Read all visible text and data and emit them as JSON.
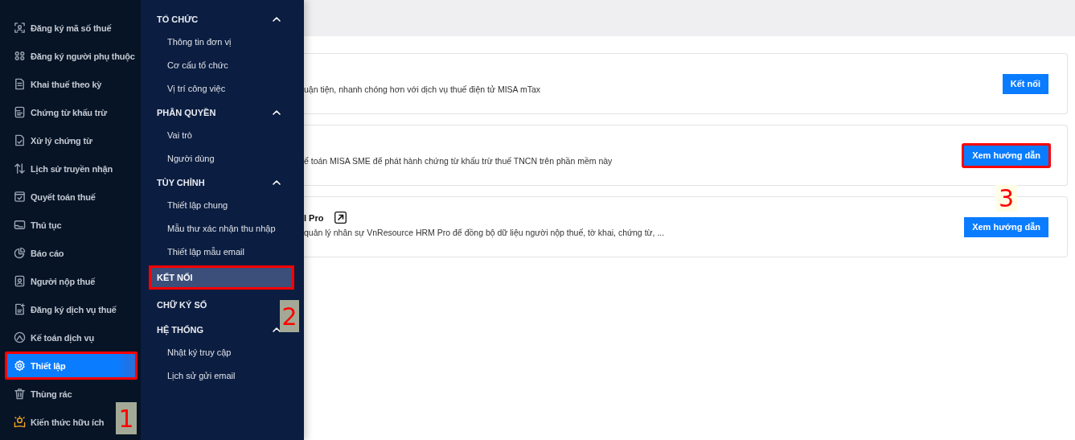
{
  "sidebar": {
    "items": [
      {
        "label": "Đăng ký mã số thuế",
        "selected": false,
        "highlighted": false
      },
      {
        "label": "Đăng ký người phụ thuộc",
        "selected": false,
        "highlighted": false
      },
      {
        "label": "Khai thuế theo kỳ",
        "selected": false,
        "highlighted": false
      },
      {
        "label": "Chứng từ khấu trừ",
        "selected": false,
        "highlighted": false
      },
      {
        "label": "Xử lý chứng từ",
        "selected": false,
        "highlighted": false
      },
      {
        "label": "Lịch sử truyền nhận",
        "selected": false,
        "highlighted": false
      },
      {
        "label": "Quyết toán thuế",
        "selected": false,
        "highlighted": false
      },
      {
        "label": "Thủ tục",
        "selected": false,
        "highlighted": false
      },
      {
        "label": "Báo cáo",
        "selected": false,
        "highlighted": false
      },
      {
        "label": "Người nộp thuế",
        "selected": false,
        "highlighted": false
      },
      {
        "label": "Đăng ký dịch vụ thuế",
        "selected": false,
        "highlighted": false
      },
      {
        "label": "Kế toán dịch vụ",
        "selected": false,
        "highlighted": false
      },
      {
        "label": "Thiết lập",
        "selected": true,
        "highlighted": true
      },
      {
        "label": "Thùng rác",
        "selected": false,
        "highlighted": false
      },
      {
        "label": "Kiến thức hữu ích",
        "selected": false,
        "highlighted": false
      }
    ]
  },
  "settings_menu": {
    "sections": [
      {
        "kind": "group",
        "title": "TỔ CHỨC",
        "expanded": true,
        "selected": false,
        "highlighted": false,
        "children": [
          {
            "label": "Thông tin đơn vị",
            "selected": false
          },
          {
            "label": "Cơ cấu tổ chức",
            "selected": false
          },
          {
            "label": "Vị trí công việc",
            "selected": false
          }
        ]
      },
      {
        "kind": "group",
        "title": "PHÂN QUYỀN",
        "expanded": true,
        "selected": false,
        "highlighted": false,
        "children": [
          {
            "label": "Vai trò",
            "selected": false
          },
          {
            "label": "Người dùng",
            "selected": false
          }
        ]
      },
      {
        "kind": "group",
        "title": "TÙY CHỈNH",
        "expanded": true,
        "selected": false,
        "highlighted": false,
        "children": [
          {
            "label": "Thiết lập chung",
            "selected": false
          },
          {
            "label": "Mẫu thư xác nhận thu nhập",
            "selected": false
          },
          {
            "label": "Thiết lập mẫu email",
            "selected": false
          }
        ]
      },
      {
        "kind": "link",
        "title": "KẾT NỐI",
        "selected": true,
        "highlighted": true
      },
      {
        "kind": "link",
        "title": "CHỮ KÝ SỐ",
        "selected": false,
        "highlighted": false
      },
      {
        "kind": "group",
        "title": "HỆ THỐNG",
        "expanded": true,
        "selected": false,
        "highlighted": false,
        "children": [
          {
            "label": "Nhật ký truy cập",
            "selected": false
          },
          {
            "label": "Lịch sử gửi email",
            "selected": false
          }
        ]
      }
    ]
  },
  "connections": {
    "cards": [
      {
        "description": "uận tiện, nhanh chóng hơn với dịch vụ thuế điện tử MISA mTax",
        "button": {
          "label": "Kết nối",
          "highlighted": false
        }
      },
      {
        "description": "ế toán MISA SME để phát hành chứng từ khấu trừ thuế TNCN trên phần mềm này",
        "button": {
          "label": "Xem hướng dẫn",
          "highlighted": true
        }
      },
      {
        "title": "l Pro",
        "external_link": true,
        "description": "quản lý nhân sự VnResource HRM Pro để đồng bộ dữ liệu người nộp thuế, tờ khai, chứng từ, ...",
        "button": {
          "label": "Xem hướng dẫn",
          "highlighted": false
        }
      }
    ]
  },
  "callouts": [
    {
      "label": "1"
    },
    {
      "label": "2"
    },
    {
      "label": "3"
    }
  ]
}
